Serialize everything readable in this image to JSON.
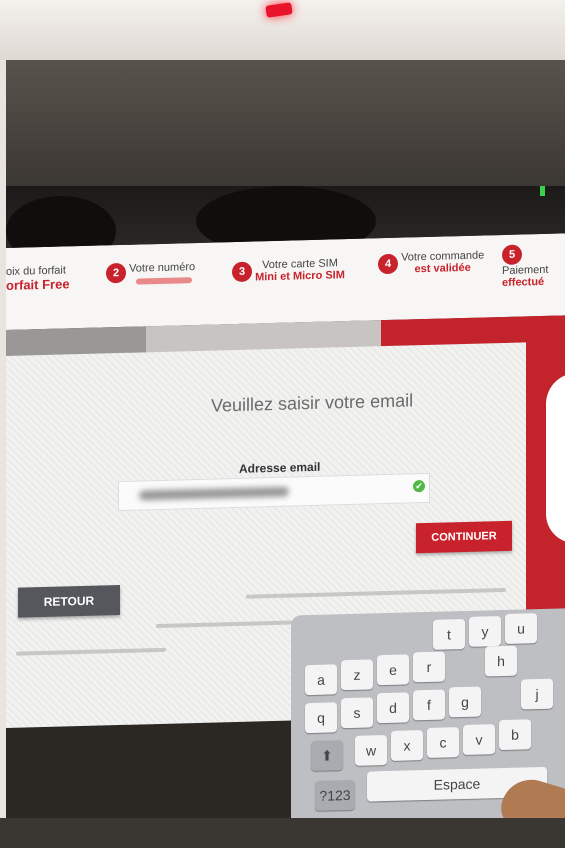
{
  "steps": [
    {
      "num": "",
      "label": "oix du forfait",
      "sub": "orfait Free"
    },
    {
      "num": "2",
      "label": "Votre numéro",
      "sub": ""
    },
    {
      "num": "3",
      "label": "Votre carte SIM",
      "sub": "Mini et Micro SIM"
    },
    {
      "num": "4",
      "label": "Votre commande",
      "sub": "est validée"
    },
    {
      "num": "5",
      "label": "Paiement",
      "sub": "effectué"
    }
  ],
  "form": {
    "title": "Veuillez saisir votre email",
    "email_label": "Adresse email",
    "email_value": "",
    "continue_label": "CONTINUER",
    "back_label": "RETOUR"
  },
  "keyboard": {
    "row1": [
      "t",
      "y",
      "u"
    ],
    "row2": [
      "a",
      "z",
      "e",
      "r",
      "h"
    ],
    "row3": [
      "q",
      "s",
      "d",
      "f",
      "g",
      "j"
    ],
    "row4": [
      "w",
      "x",
      "c",
      "v",
      "b"
    ],
    "shift": "⬆",
    "space": "Espace",
    "num": "?123"
  },
  "colors": {
    "accent": "#c8232c",
    "button_dark": "#55575c",
    "success": "#52b848"
  }
}
